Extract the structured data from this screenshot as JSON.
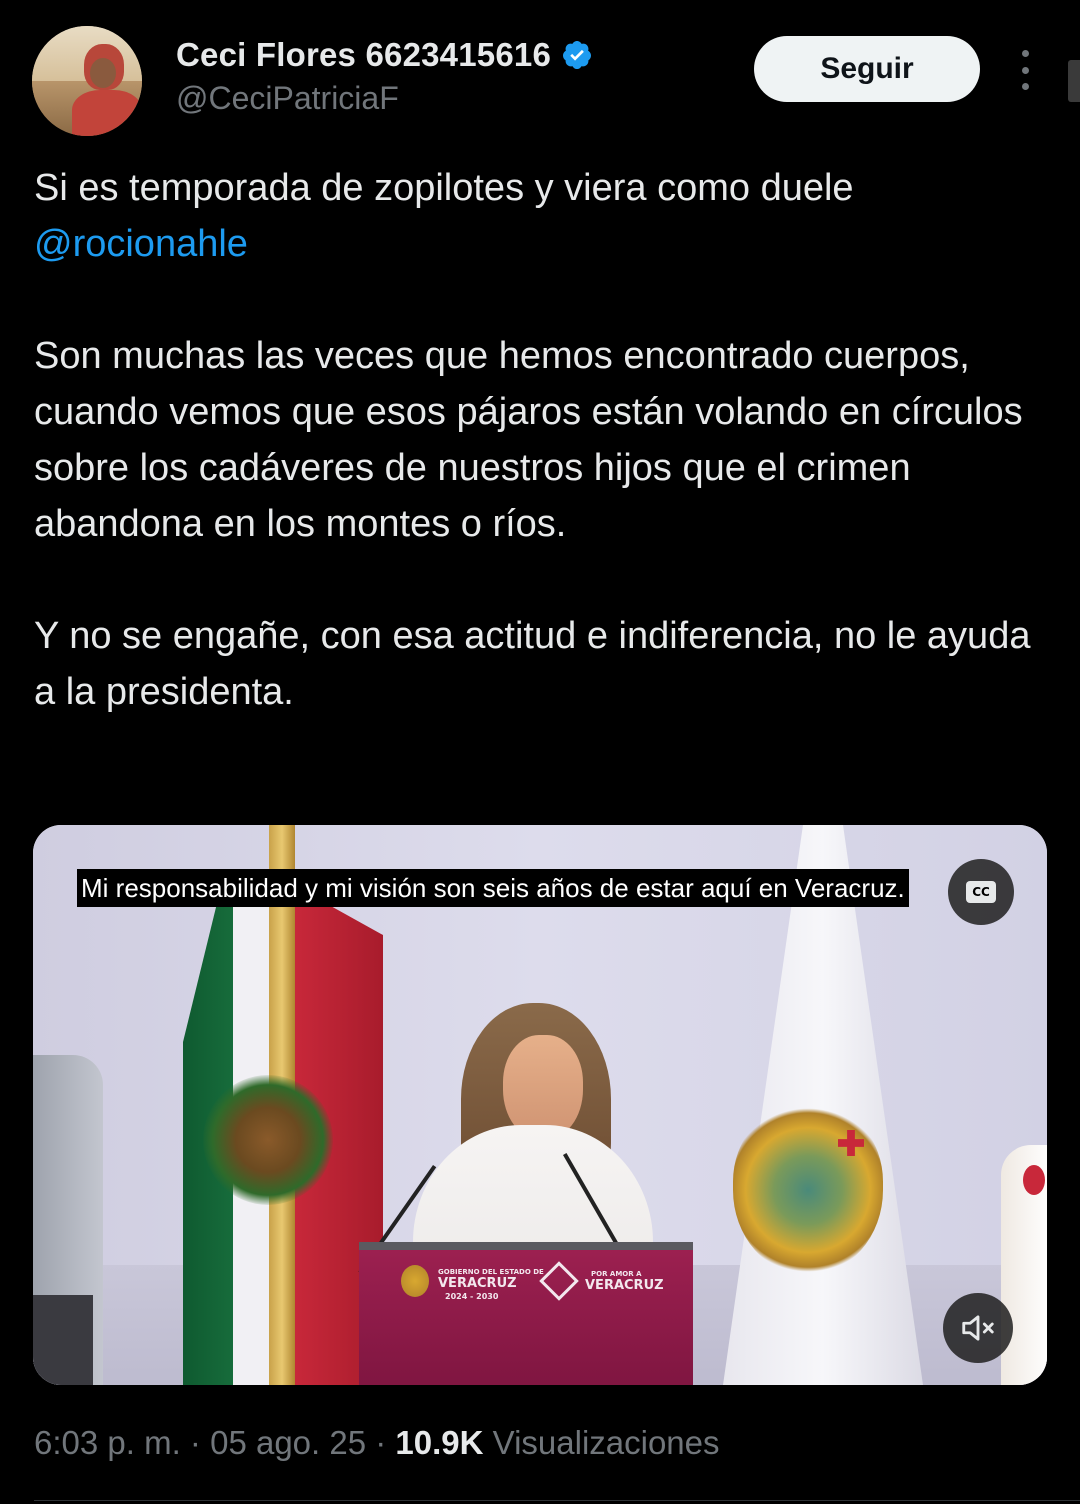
{
  "author": {
    "display_name": "Ceci Flores 6623415616",
    "handle": "@CeciPatriciaF",
    "verified": true
  },
  "header": {
    "follow_label": "Seguir",
    "more_icon": "more-vertical-icon"
  },
  "tweet": {
    "line1": "Si es temporada de zopilotes y viera como duele",
    "mention": "@rocionahle",
    "paragraph2": "Son muchas las veces que hemos encontrado cuerpos, cuando vemos que esos pájaros están volando en círculos sobre los cadáveres de nuestros hijos que el crimen abandona en los montes o ríos.",
    "paragraph3": "Y no se engañe, con esa actitud e indiferencia, no le ayuda a la presidenta."
  },
  "media": {
    "caption": "Mi responsabilidad y mi visión son seis años de estar aquí en Veracruz.",
    "cc_label": "CC",
    "podium": {
      "left_small": "GOBIERNO DEL ESTADO DE",
      "left_big": "VERACRUZ",
      "left_years": "2024 - 2030",
      "right_small": "POR AMOR A",
      "right_big": "VERACRUZ"
    }
  },
  "meta": {
    "time": "6:03 p. m.",
    "date": "05 ago. 25",
    "views_count": "10.9K",
    "views_label": "Visualizaciones",
    "separator": "·"
  },
  "colors": {
    "background": "#000000",
    "text": "#e7e9ea",
    "muted": "#71767b",
    "link": "#1d9bf0",
    "verified": "#1d9bf0",
    "button_bg": "#eff3f4"
  }
}
